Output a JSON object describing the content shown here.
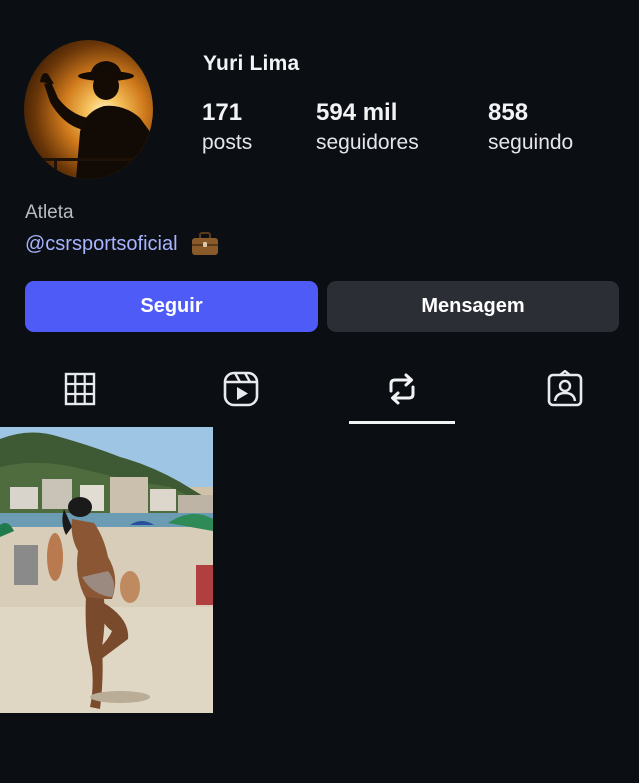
{
  "profile": {
    "username": "Yuri Lima",
    "avatar_icon": "profile-photo"
  },
  "stats": {
    "posts": {
      "value": "171",
      "label": "posts"
    },
    "followers": {
      "value": "594 mil",
      "label": "seguidores"
    },
    "following": {
      "value": "858",
      "label": "seguindo"
    }
  },
  "bio": {
    "category": "Atleta",
    "link_text": "@csrsportsoficial",
    "link_icon": "briefcase-icon"
  },
  "actions": {
    "follow_label": "Seguir",
    "message_label": "Mensagem"
  },
  "tabs": [
    {
      "name": "grid",
      "icon": "grid-icon",
      "selected": false
    },
    {
      "name": "reels",
      "icon": "reels-icon",
      "selected": false
    },
    {
      "name": "reposts",
      "icon": "repost-icon",
      "selected": true
    },
    {
      "name": "tagged",
      "icon": "tagged-icon",
      "selected": false
    }
  ],
  "posts": [
    {
      "type": "photo",
      "subject": "beach photo"
    }
  ],
  "colors": {
    "background": "#0b0e13",
    "follow_button": "#4f5bf6",
    "message_button": "#2b2e35",
    "link": "#a8b4ff"
  }
}
